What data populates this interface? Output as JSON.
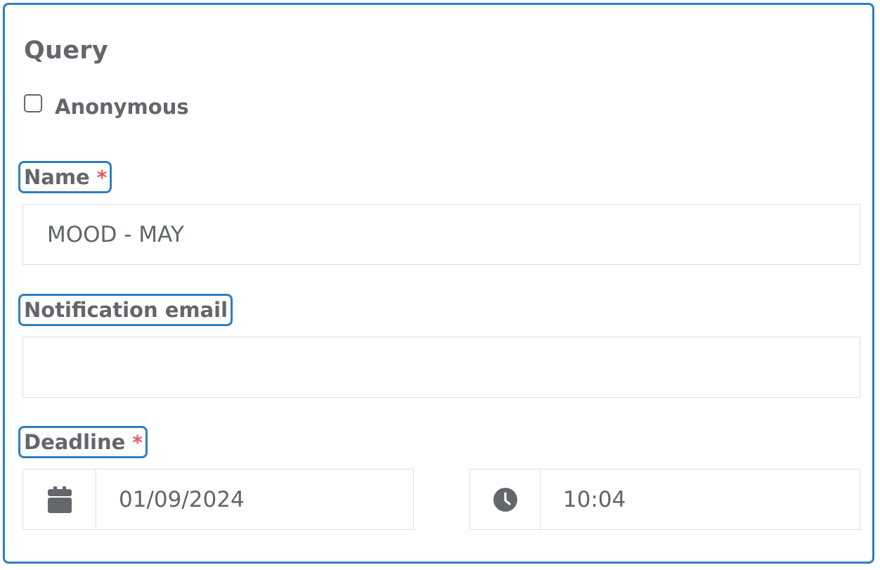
{
  "form": {
    "title": "Query",
    "anonymous": {
      "label": "Anonymous",
      "checked": false
    },
    "name": {
      "label": "Name",
      "required_mark": "*",
      "value": "MOOD - MAY"
    },
    "notification_email": {
      "label": "Notification email",
      "value": ""
    },
    "deadline": {
      "label": "Deadline",
      "required_mark": "*",
      "date": "01/09/2024",
      "time": "10:04",
      "date_icon": "calendar-icon",
      "time_icon": "clock-icon"
    }
  },
  "colors": {
    "highlight_border": "#2f7ec2",
    "text": "#63676c",
    "required": "#e4595f",
    "input_border": "#dedfe1"
  }
}
